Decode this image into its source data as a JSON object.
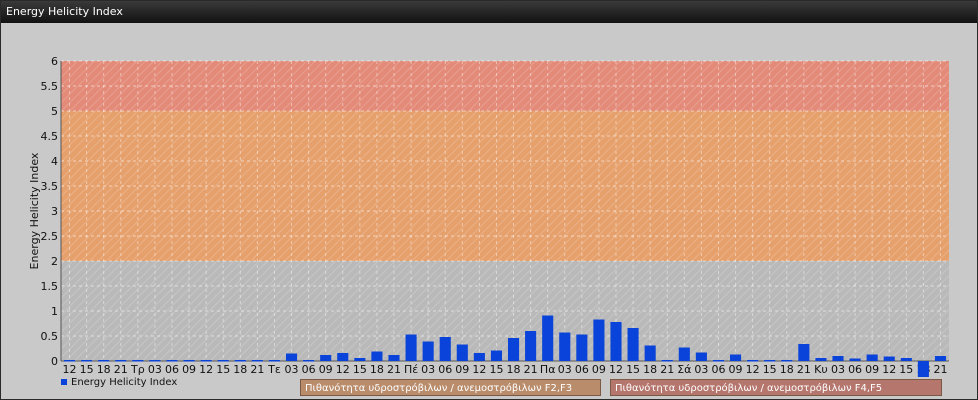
{
  "window": {
    "title": "Energy Helicity Index"
  },
  "chart_data": {
    "type": "bar",
    "title": "",
    "xlabel": "",
    "ylabel": "Energy Helicity Index",
    "ylim": [
      0,
      6
    ],
    "yticks": [
      "0",
      "0.5",
      "1",
      "1.5",
      "2",
      "2.5",
      "3",
      "3.5",
      "4",
      "4.5",
      "5",
      "5.5",
      "6"
    ],
    "grid": true,
    "legend_position": "bottom-left",
    "bar_color": "#0a43d9",
    "zones": [
      {
        "from": 0,
        "to": 2,
        "color": "#b9b9b9"
      },
      {
        "from": 2,
        "to": 5,
        "color": "#e6a06c"
      },
      {
        "from": 5,
        "to": 6,
        "color": "#e38a78"
      }
    ],
    "categories": [
      "12",
      "15",
      "18",
      "21",
      "Τρ",
      "03",
      "06",
      "09",
      "12",
      "15",
      "18",
      "21",
      "Τε",
      "03",
      "06",
      "09",
      "12",
      "15",
      "18",
      "21",
      "Πέ",
      "03",
      "06",
      "09",
      "12",
      "15",
      "18",
      "21",
      "Πα",
      "03",
      "06",
      "09",
      "12",
      "15",
      "18",
      "21",
      "Σά",
      "03",
      "06",
      "09",
      "12",
      "15",
      "18",
      "21",
      "Κυ",
      "03",
      "06",
      "09",
      "12",
      "15",
      "18",
      "21"
    ],
    "series": [
      {
        "name": "Energy Helicity Index",
        "values": [
          0.02,
          0.02,
          0.02,
          0.02,
          0.02,
          0.02,
          0.02,
          0.02,
          0.02,
          0.02,
          0.02,
          0.02,
          0.02,
          0.15,
          0.02,
          0.12,
          0.16,
          0.06,
          0.19,
          0.12,
          0.53,
          0.39,
          0.48,
          0.33,
          0.16,
          0.21,
          0.46,
          0.6,
          0.91,
          0.57,
          0.53,
          0.83,
          0.78,
          0.66,
          0.31,
          0.02,
          0.27,
          0.17,
          0.02,
          0.13,
          0.02,
          0.02,
          0.02,
          0.34,
          0.06,
          0.1,
          0.05,
          0.13,
          0.09,
          0.06,
          -0.32,
          0.1
        ]
      }
    ],
    "legend": [
      "Energy Helicity Index"
    ],
    "zone_labels": [
      "Πιθανότητα υδροστρόβιλων / ανεμοστρόβιλων F2,F3",
      "Πιθανότητα υδροστρόβιλων / ανεμοστρόβιλων F4,F5"
    ]
  }
}
